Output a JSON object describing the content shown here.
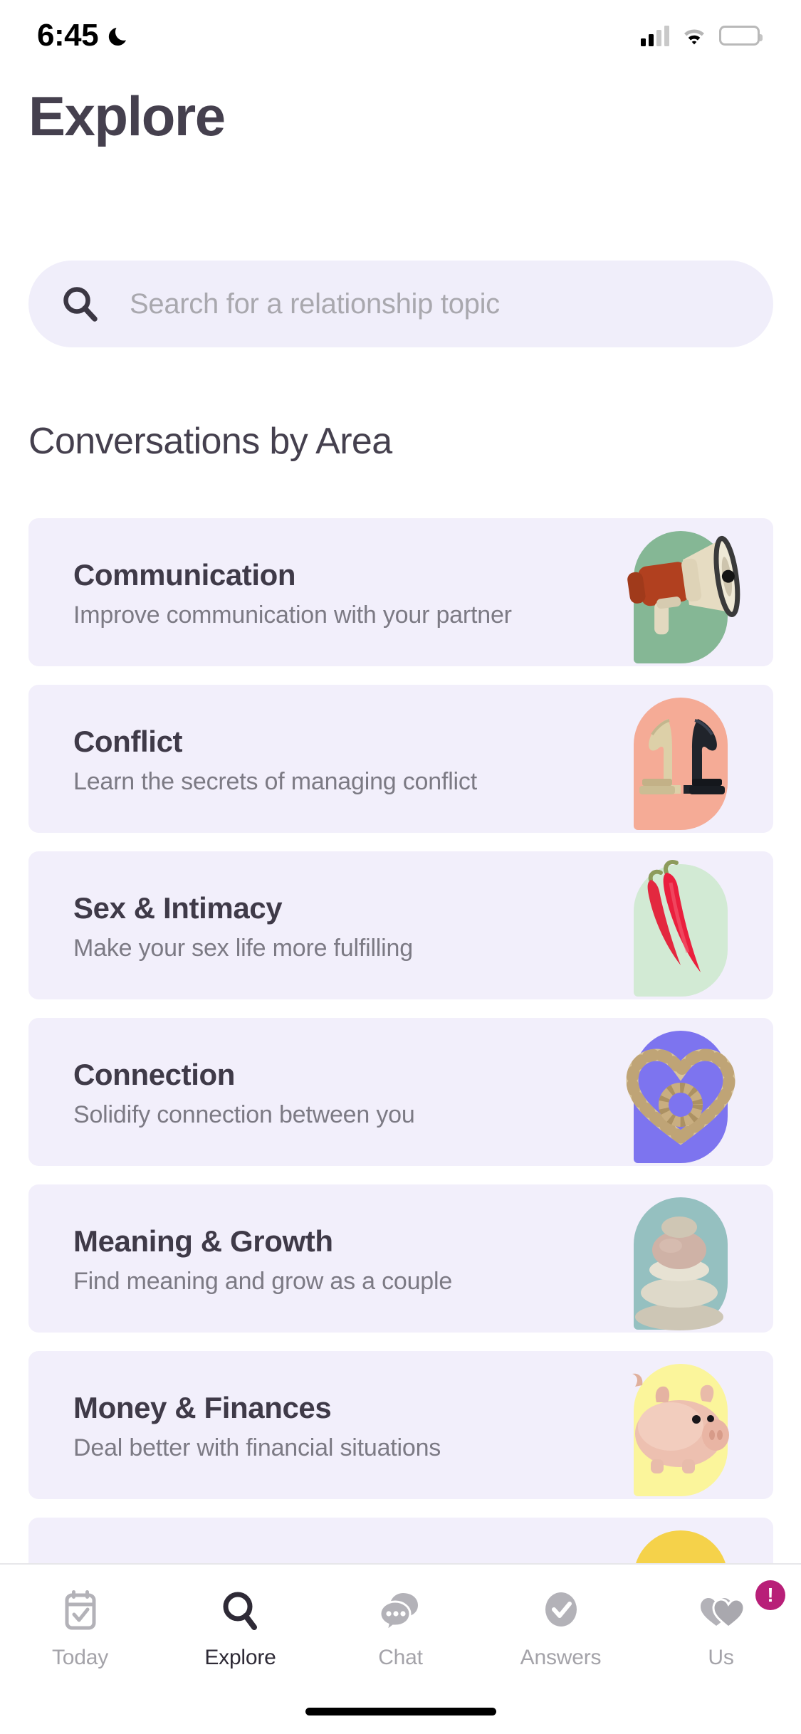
{
  "status_bar": {
    "time": "6:45",
    "dnd_icon": "crescent-moon-icon",
    "signal_icon": "cellular-signal-icon",
    "wifi_icon": "wifi-icon",
    "battery_icon": "battery-icon"
  },
  "header": {
    "title": "Explore"
  },
  "search": {
    "icon": "search-icon",
    "placeholder": "Search for a relationship topic",
    "value": ""
  },
  "section": {
    "title": "Conversations by Area"
  },
  "cards": [
    {
      "title": "Communication",
      "subtitle": "Improve communication with your partner",
      "art": "megaphone-icon",
      "arch_color": "#85b795"
    },
    {
      "title": "Conflict",
      "subtitle": "Learn the secrets of managing conflict",
      "art": "chess-knights-icon",
      "arch_color": "#f5ab96"
    },
    {
      "title": "Sex & Intimacy",
      "subtitle": "Make your sex life more fulfilling",
      "art": "chili-peppers-icon",
      "arch_color": "#d2ead4"
    },
    {
      "title": "Connection",
      "subtitle": "Solidify connection between you",
      "art": "rope-heart-icon",
      "arch_color": "#7d74ef"
    },
    {
      "title": "Meaning & Growth",
      "subtitle": "Find meaning and grow as a couple",
      "art": "balanced-stones-icon",
      "arch_color": "#95c0c0"
    },
    {
      "title": "Money & Finances",
      "subtitle": "Deal better with financial situations",
      "art": "piggy-bank-icon",
      "arch_color": "#fbf59b"
    },
    {
      "title": "",
      "subtitle": "",
      "art": "partial-card-icon",
      "arch_color": "#f5d24a"
    }
  ],
  "tabs": [
    {
      "label": "Today",
      "icon": "calendar-check-icon",
      "active": false,
      "badge": ""
    },
    {
      "label": "Explore",
      "icon": "search-icon",
      "active": true,
      "badge": ""
    },
    {
      "label": "Chat",
      "icon": "chat-bubbles-icon",
      "active": false,
      "badge": ""
    },
    {
      "label": "Answers",
      "icon": "check-circle-icon",
      "active": false,
      "badge": ""
    },
    {
      "label": "Us",
      "icon": "two-hearts-icon",
      "active": false,
      "badge": "!"
    }
  ],
  "colors": {
    "card_bg": "#f2effb",
    "search_bg": "#f0eefa",
    "title": "#45404e",
    "subtitle": "#7c7a84",
    "badge": "#b81f78",
    "tab_inactive": "#a4a3a9",
    "tab_active": "#2e2a36"
  }
}
